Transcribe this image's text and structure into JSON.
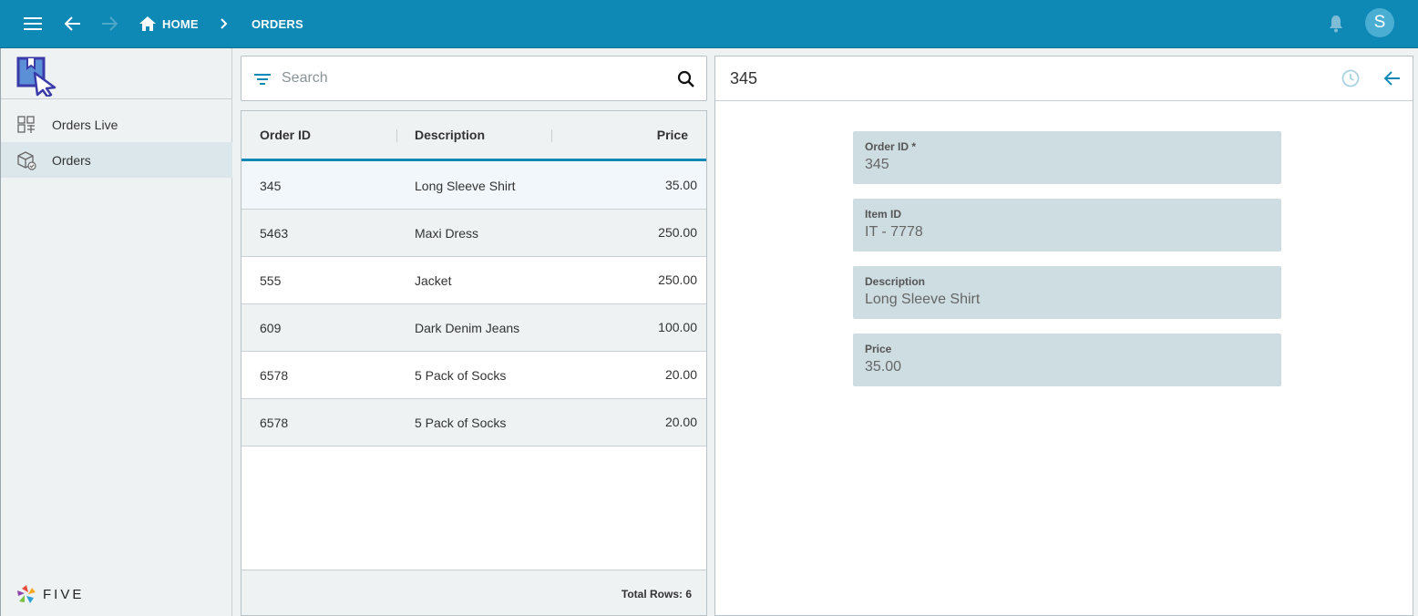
{
  "topbar": {
    "breadcrumb": [
      {
        "label": "HOME"
      },
      {
        "label": "ORDERS"
      }
    ],
    "avatar_initial": "S"
  },
  "sidebar": {
    "items": [
      {
        "label": "Orders Live",
        "icon": "conveyor-icon",
        "selected": false
      },
      {
        "label": "Orders",
        "icon": "package-icon",
        "selected": true
      }
    ],
    "brand": "FIVE"
  },
  "search": {
    "placeholder": "Search",
    "value": ""
  },
  "grid": {
    "columns": [
      "Order ID",
      "Description",
      "Price"
    ],
    "rows": [
      {
        "order_id": "345",
        "description": "Long Sleeve Shirt",
        "price": "35.00"
      },
      {
        "order_id": "5463",
        "description": "Maxi Dress",
        "price": "250.00"
      },
      {
        "order_id": "555",
        "description": "Jacket",
        "price": "250.00"
      },
      {
        "order_id": "609",
        "description": "Dark Denim Jeans",
        "price": "100.00"
      },
      {
        "order_id": "6578",
        "description": "5 Pack of Socks",
        "price": "20.00"
      },
      {
        "order_id": "6578",
        "description": "5 Pack of Socks",
        "price": "20.00"
      }
    ],
    "total_label": "Total Rows: 6"
  },
  "detail": {
    "title": "345",
    "fields": [
      {
        "label": "Order ID *",
        "value": "345"
      },
      {
        "label": "Item ID",
        "value": "IT - 7778"
      },
      {
        "label": "Description",
        "value": "Long Sleeve Shirt"
      },
      {
        "label": "Price",
        "value": "35.00"
      }
    ]
  },
  "colors": {
    "accent": "#0e88b5",
    "panel_bg": "#eef2f3",
    "field_bg": "#cddde2"
  }
}
